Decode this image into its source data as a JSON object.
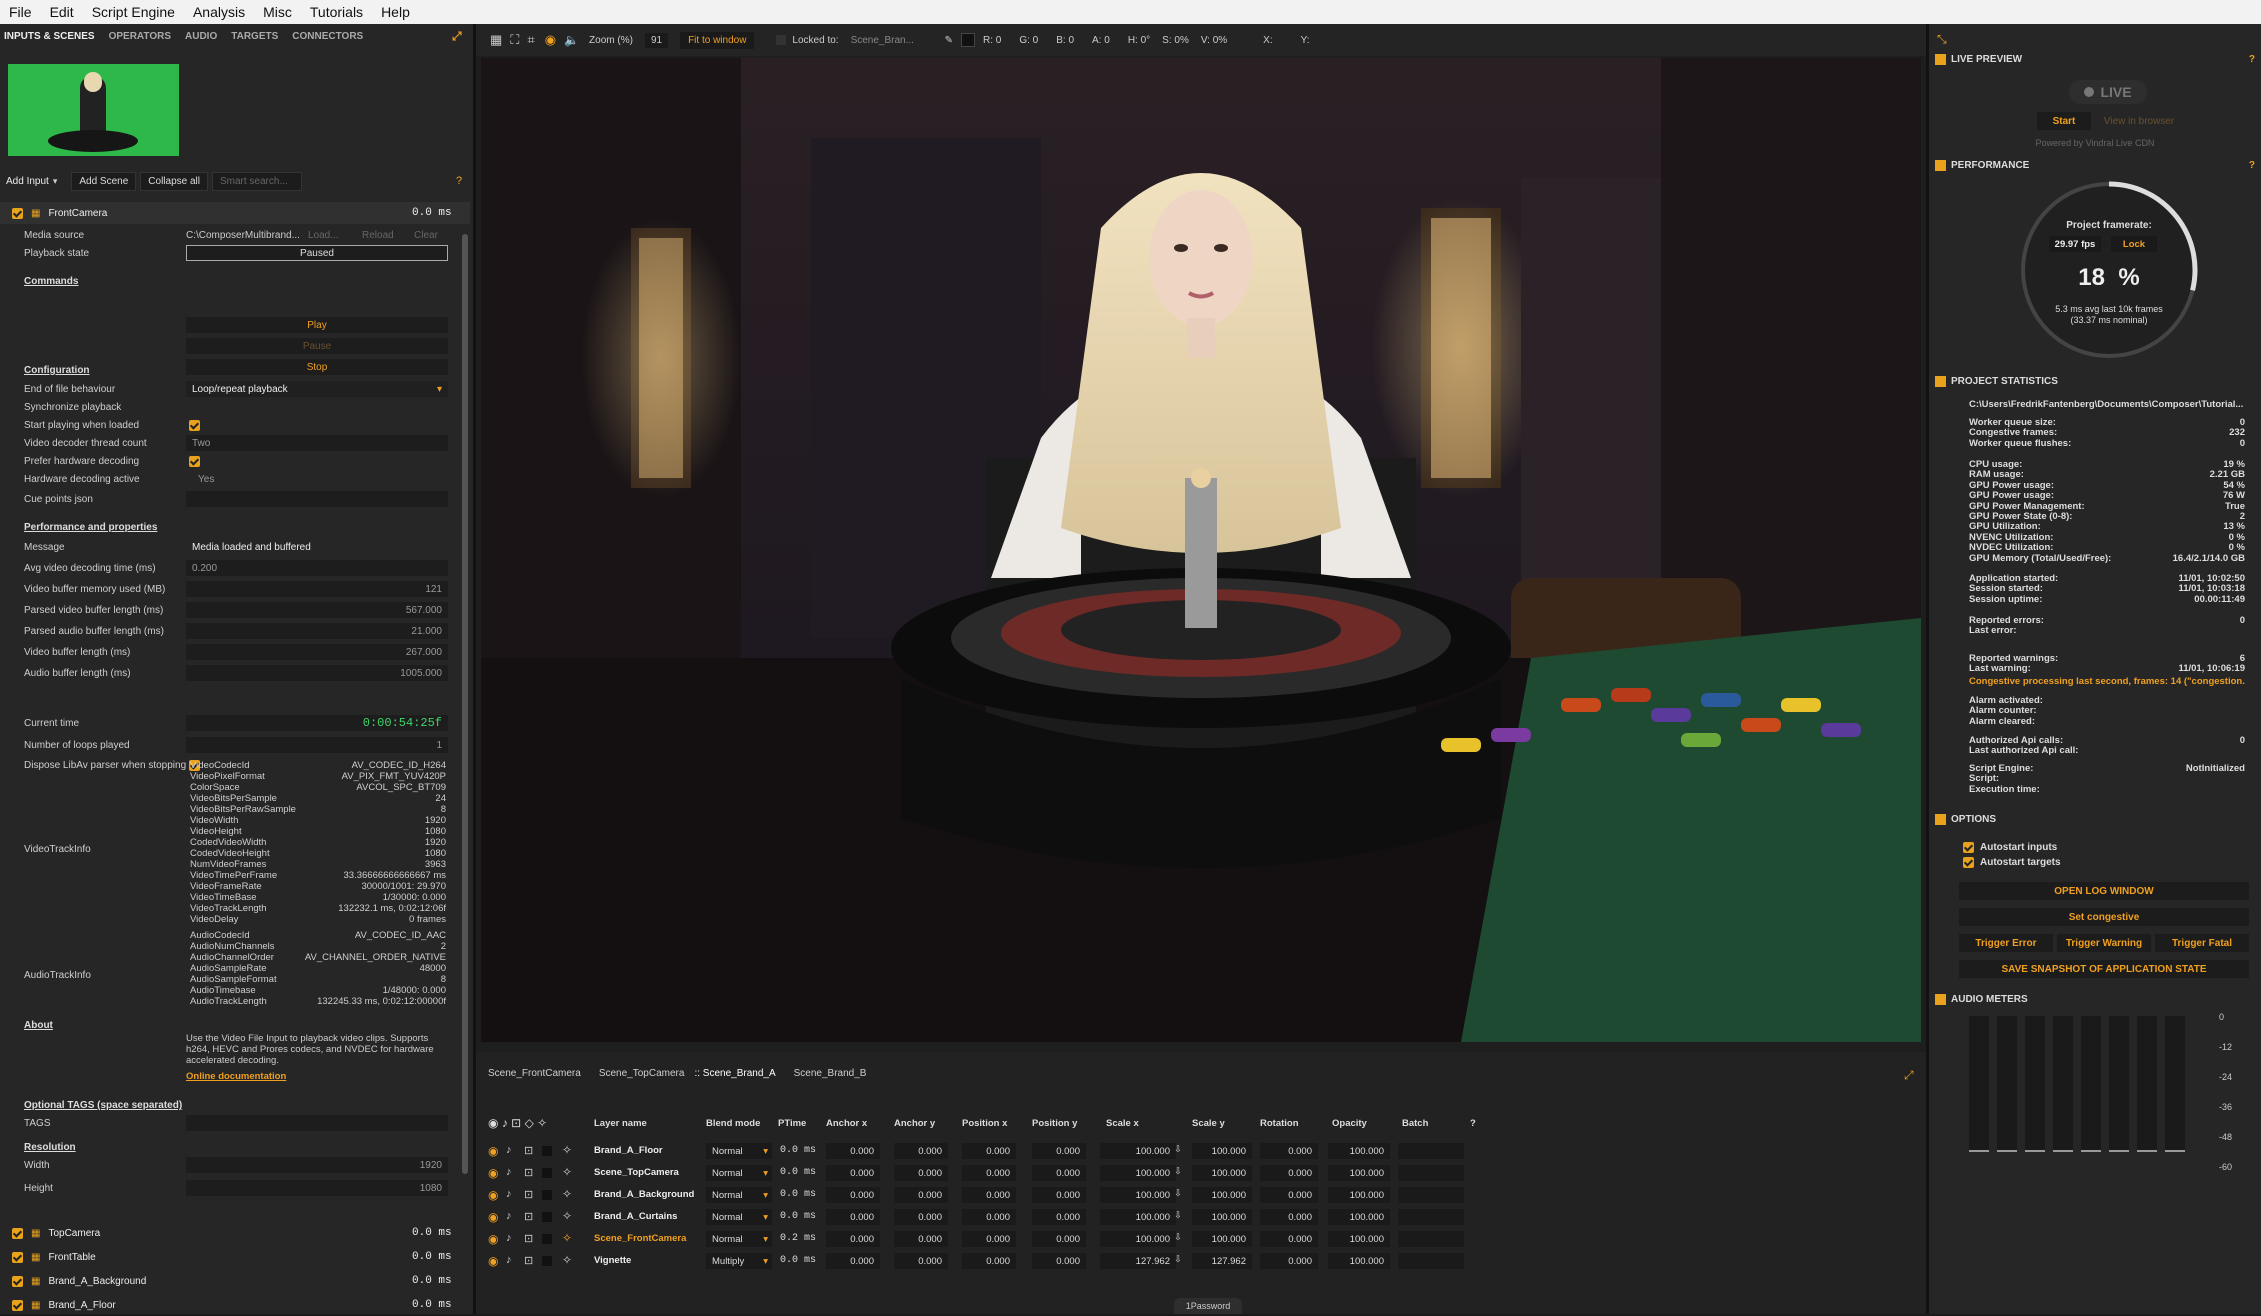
{
  "menu": [
    "File",
    "Edit",
    "Script Engine",
    "Analysis",
    "Misc",
    "Tutorials",
    "Help"
  ],
  "left_tabs": [
    "INPUTS & SCENES",
    "OPERATORS",
    "AUDIO",
    "TARGETS",
    "CONNECTORS"
  ],
  "toolbar": {
    "add_input": "Add Input",
    "add_scene": "Add Scene",
    "collapse_all": "Collapse all",
    "search_placeholder": "Smart search..."
  },
  "input": {
    "name": "FrontCamera",
    "time": "0.0 ms",
    "media_source_label": "Media source",
    "media_source": "C:\\ComposerMultibrand...",
    "load": "Load...",
    "reload": "Reload",
    "clear": "Clear",
    "playback_state_label": "Playback state",
    "playback_state": "Paused",
    "commands": "Commands",
    "play": "Play",
    "pause": "Pause",
    "stop": "Stop",
    "configuration": "Configuration",
    "eof_label": "End of file behaviour",
    "eof": "Loop/repeat playback",
    "sync_label": "Synchronize playback",
    "start_label": "Start playing when loaded",
    "threads_label": "Video decoder thread count",
    "threads": "Two",
    "hw_label": "Prefer hardware decoding",
    "hw_active_label": "Hardware decoding active",
    "hw_active": "Yes",
    "cue_label": "Cue points json",
    "perf": "Performance and properties",
    "message_label": "Message",
    "message": "Media loaded and buffered",
    "avgdec_label": "Avg video decoding time (ms)",
    "avgdec": "0.200",
    "vbufmem_label": "Video buffer memory used (MB)",
    "vbufmem": "121",
    "pvbuf_label": "Parsed video buffer length (ms)",
    "pvbuf": "567.000",
    "pabuf_label": "Parsed audio buffer length (ms)",
    "pabuf": "21.000",
    "vbuf_label": "Video buffer length (ms)",
    "vbuf": "267.000",
    "abuf_label": "Audio buffer length (ms)",
    "abuf": "1005.000",
    "curtime_label": "Current time",
    "curtime": "0:00:54:25f",
    "loops_label": "Number of loops played",
    "loops": "1",
    "dispose_label": "Dispose LibAv parser when stopping",
    "vti_label": "VideoTrackInfo",
    "vti": [
      [
        "VideoCodecId",
        "AV_CODEC_ID_H264"
      ],
      [
        "VideoPixelFormat",
        "AV_PIX_FMT_YUV420P"
      ],
      [
        "ColorSpace",
        "AVCOL_SPC_BT709"
      ],
      [
        "VideoBitsPerSample",
        "24"
      ],
      [
        "VideoBitsPerRawSample",
        "8"
      ],
      [
        "VideoWidth",
        "1920"
      ],
      [
        "VideoHeight",
        "1080"
      ],
      [
        "CodedVideoWidth",
        "1920"
      ],
      [
        "CodedVideoHeight",
        "1080"
      ],
      [
        "NumVideoFrames",
        "3963"
      ],
      [
        "VideoTimePerFrame",
        "33.36666666666667 ms"
      ],
      [
        "VideoFrameRate",
        "30000/1001: 29.970"
      ],
      [
        "VideoTimeBase",
        "1/30000: 0.000"
      ],
      [
        "VideoTrackLength",
        "132232.1 ms, 0:02:12:06f"
      ],
      [
        "VideoDelay",
        "0 frames"
      ]
    ],
    "ati_label": "AudioTrackInfo",
    "ati": [
      [
        "AudioCodecId",
        "AV_CODEC_ID_AAC"
      ],
      [
        "AudioNumChannels",
        "2"
      ],
      [
        "AudioChannelOrder",
        "AV_CHANNEL_ORDER_NATIVE"
      ],
      [
        "AudioSampleRate",
        "48000"
      ],
      [
        "AudioSampleFormat",
        "8"
      ],
      [
        "AudioTimebase",
        "1/48000: 0.000"
      ],
      [
        "AudioTrackLength",
        "132245.33 ms, 0:02:12:00000f"
      ]
    ],
    "about": "About",
    "about_text": "Use the Video File Input to playback video clips. Supports h264, HEVC and Prores codecs, and NVDEC for hardware accelerated decoding.",
    "docs": "Online documentation",
    "tags_sec": "Optional TAGS (space separated)",
    "tags_label": "TAGS",
    "res_sec": "Resolution",
    "width_label": "Width",
    "width": "1920",
    "height_label": "Height",
    "height": "1080"
  },
  "inputs": [
    {
      "name": "TopCamera",
      "time": "0.0 ms"
    },
    {
      "name": "FrontTable",
      "time": "0.0 ms"
    },
    {
      "name": "Brand_A_Background",
      "time": "0.0 ms"
    },
    {
      "name": "Brand_A_Floor",
      "time": "0.0 ms"
    }
  ],
  "viewer": {
    "zoom_label": "Zoom (%)",
    "zoom": "91",
    "fit": "Fit to window",
    "locked_label": "Locked to:",
    "locked": "Scene_Bran...",
    "r": "R: 0",
    "g": "G: 0",
    "b": "B: 0",
    "a": "A: 0",
    "h": "H: 0°",
    "s": "S: 0%",
    "v": "V: 0%",
    "x": "X:",
    "y": "Y:"
  },
  "scene_tabs": [
    "Scene_FrontCamera",
    "Scene_TopCamera",
    "Scene_Brand_A",
    "Scene_Brand_B"
  ],
  "layer_headers": [
    "Layer name",
    "Blend mode",
    "PTime",
    "Anchor x",
    "Anchor y",
    "Position x",
    "Position y",
    "Scale x",
    "Scale y",
    "Rotation",
    "Opacity",
    "Batch"
  ],
  "layers": [
    {
      "name": "Brand_A_Floor",
      "blend": "Normal",
      "ptime": "0.0 ms",
      "ax": "0.000",
      "ay": "0.000",
      "px": "0.000",
      "py": "0.000",
      "sx": "100.000",
      "sy": "100.000",
      "rot": "0.000",
      "op": "100.000"
    },
    {
      "name": "Scene_TopCamera",
      "blend": "Normal",
      "ptime": "0.0 ms",
      "ax": "0.000",
      "ay": "0.000",
      "px": "0.000",
      "py": "0.000",
      "sx": "100.000",
      "sy": "100.000",
      "rot": "0.000",
      "op": "100.000"
    },
    {
      "name": "Brand_A_Background",
      "blend": "Normal",
      "ptime": "0.0 ms",
      "ax": "0.000",
      "ay": "0.000",
      "px": "0.000",
      "py": "0.000",
      "sx": "100.000",
      "sy": "100.000",
      "rot": "0.000",
      "op": "100.000"
    },
    {
      "name": "Brand_A_Curtains",
      "blend": "Normal",
      "ptime": "0.0 ms",
      "ax": "0.000",
      "ay": "0.000",
      "px": "0.000",
      "py": "0.000",
      "sx": "100.000",
      "sy": "100.000",
      "rot": "0.000",
      "op": "100.000"
    },
    {
      "name": "Scene_FrontCamera",
      "blend": "Normal",
      "ptime": "0.2 ms",
      "ax": "0.000",
      "ay": "0.000",
      "px": "0.000",
      "py": "0.000",
      "sx": "100.000",
      "sy": "100.000",
      "rot": "0.000",
      "op": "100.000"
    },
    {
      "name": "Vignette",
      "blend": "Multiply",
      "ptime": "0.0 ms",
      "ax": "0.000",
      "ay": "0.000",
      "px": "0.000",
      "py": "0.000",
      "sx": "127.962",
      "sy": "127.962",
      "rot": "0.000",
      "op": "100.000"
    }
  ],
  "bottom_label": "1Password",
  "right": {
    "live_preview": "LIVE PREVIEW",
    "live": "LIVE",
    "start": "Start",
    "view_browser": "View in browser",
    "powered": "Powered by Vindral Live CDN",
    "performance": "PERFORMANCE",
    "project_fr": "Project framerate:",
    "fps": "29.97 fps",
    "lock": "Lock",
    "percent": "18",
    "pct": "%",
    "avg1": "5.3 ms avg last 10k frames",
    "avg2": "(33.37 ms nominal)",
    "gauge_fraction": 0.18,
    "project_stats": "PROJECT STATISTICS",
    "path": "C:\\Users\\FredrikFantenberg\\Documents\\Composer\\Tutorial...",
    "stats1": [
      [
        "Worker queue size:",
        "0"
      ],
      [
        "Congestive frames:",
        "232"
      ],
      [
        "Worker queue flushes:",
        "0"
      ]
    ],
    "stats2": [
      [
        "CPU usage:",
        "19 %"
      ],
      [
        "RAM usage:",
        "2.21 GB"
      ],
      [
        "GPU Power usage:",
        "54 %"
      ],
      [
        "GPU Power usage:",
        "76 W"
      ],
      [
        "GPU Power Management:",
        "True"
      ],
      [
        "GPU Power State (0-8):",
        "2"
      ],
      [
        "GPU Utilization:",
        "13 %"
      ],
      [
        "NVENC Utilization:",
        "0 %"
      ],
      [
        "NVDEC Utilization:",
        "0 %"
      ],
      [
        "GPU Memory (Total/Used/Free):",
        "16.4/2.1/14.0 GB"
      ]
    ],
    "stats3": [
      [
        "Application started:",
        "11/01, 10:02:50"
      ],
      [
        "Session started:",
        "11/01, 10:03:18"
      ],
      [
        "Session uptime:",
        "00.00:11:49"
      ]
    ],
    "stats4": [
      [
        "Reported errors:",
        "0"
      ],
      [
        "Last error:",
        ""
      ]
    ],
    "stats5": [
      [
        "Reported warnings:",
        "6"
      ],
      [
        "Last warning:",
        "11/01, 10:06:19"
      ]
    ],
    "warning_text": "Congestive processing last second, frames: 14 (\"congestion...",
    "stats6": [
      [
        "Alarm activated:",
        ""
      ],
      [
        "Alarm counter:",
        ""
      ],
      [
        "Alarm cleared:",
        ""
      ]
    ],
    "stats7": [
      [
        "Authorized Api calls:",
        "0"
      ],
      [
        "Last authorized Api call:",
        ""
      ]
    ],
    "stats8": [
      [
        "Script Engine:",
        "NotInitialized"
      ],
      [
        "Script:",
        ""
      ],
      [
        "Execution time:",
        ""
      ]
    ],
    "options": "OPTIONS",
    "autostart_inputs": "Autostart inputs",
    "autostart_targets": "Autostart targets",
    "open_log": "OPEN LOG WINDOW",
    "set_congestive": "Set congestive",
    "trigger_error": "Trigger Error",
    "trigger_warning": "Trigger Warning",
    "trigger_fatal": "Trigger Fatal",
    "snapshot": "SAVE SNAPSHOT OF APPLICATION STATE",
    "audio_meters": "AUDIO METERS",
    "meter_scale": [
      "0",
      "-12",
      "-24",
      "-36",
      "-48",
      "-60"
    ]
  },
  "colors": {
    "accent": "#f0a020",
    "panel": "#262626"
  }
}
